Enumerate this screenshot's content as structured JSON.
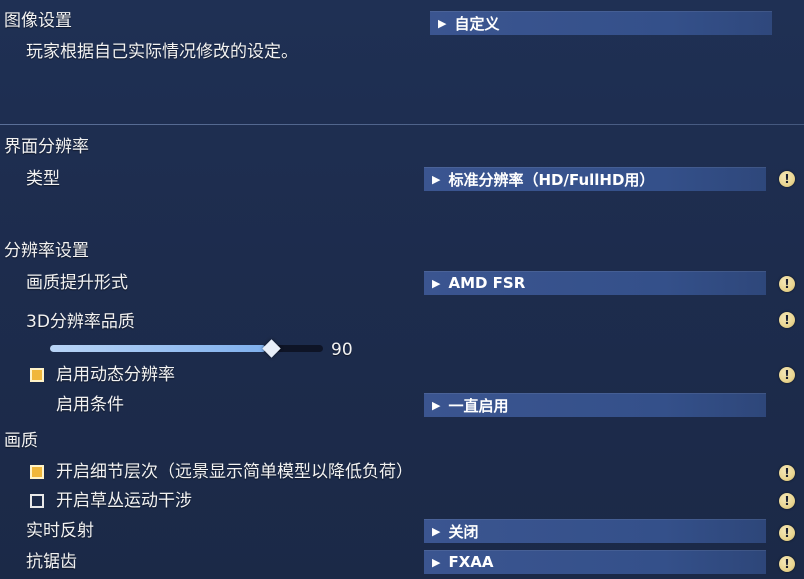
{
  "preset": {
    "title": "图像设置",
    "value": "自定义",
    "description": "玩家根据自己实际情况修改的设定。"
  },
  "sections": {
    "ui_resolution": {
      "title": "界面分辨率",
      "type_label": "类型",
      "type_value": "标准分辨率（HD/FullHD用）"
    },
    "resolution_settings": {
      "title": "分辨率设置",
      "upscaling_label": "画质提升形式",
      "upscaling_value": "AMD FSR",
      "quality_label": "3D分辨率品质",
      "quality_value": "90",
      "quality_fraction": 0.9,
      "dynamic_label": "启用动态分辨率",
      "dynamic_checked": true,
      "condition_label": "启用条件",
      "condition_value": "一直启用"
    },
    "quality": {
      "title": "画质",
      "lod_label": "开启细节层次（远景显示简单模型以降低负荷）",
      "lod_checked": true,
      "grass_label": "开启草丛运动干涉",
      "grass_checked": false,
      "reflection_label": "实时反射",
      "reflection_value": "关闭",
      "aa_label": "抗锯齿",
      "aa_value": "FXAA"
    }
  },
  "icons": {
    "dropdown_arrow": "▶",
    "warning": "!"
  },
  "colors": {
    "background": "#1d2c4d",
    "dropdown": "#34508a",
    "checkbox_on": "#f0b73b",
    "slider_fill": "#7fb0ee"
  }
}
